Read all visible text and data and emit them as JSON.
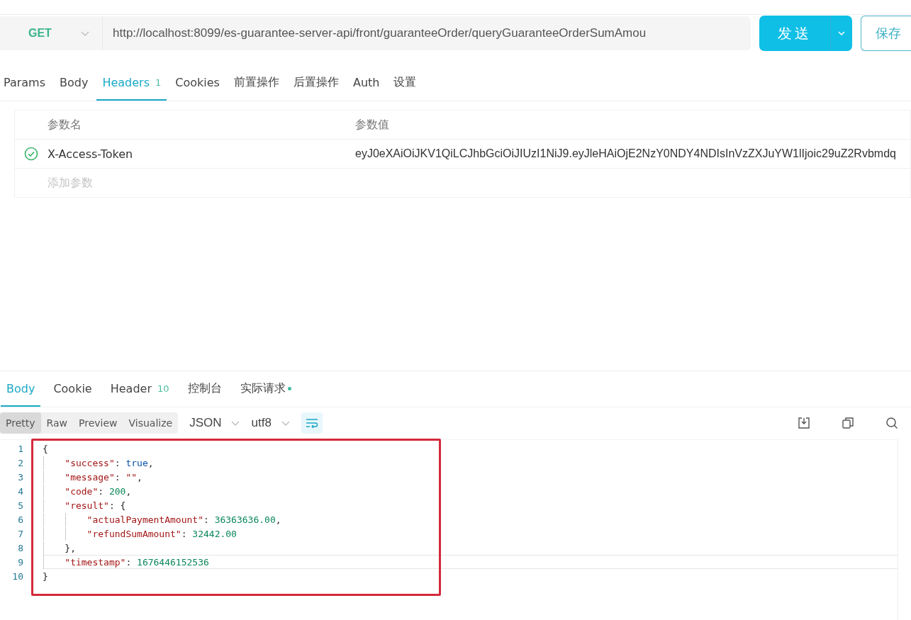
{
  "request": {
    "method": "GET",
    "url": "http://localhost:8099/es-guarantee-server-api/front/guaranteeOrder/queryGuaranteeOrderSumAmou",
    "send_label": "发送",
    "save_label": "保存"
  },
  "request_tabs": [
    {
      "label": "Params",
      "selected": false
    },
    {
      "label": "Body",
      "selected": false
    },
    {
      "label": "Headers",
      "count": "1",
      "selected": true
    },
    {
      "label": "Cookies",
      "selected": false
    },
    {
      "label": "前置操作",
      "selected": false
    },
    {
      "label": "后置操作",
      "selected": false
    },
    {
      "label": "Auth",
      "selected": false
    },
    {
      "label": "设置",
      "selected": false
    }
  ],
  "headers_table": {
    "columns": [
      "参数名",
      "参数值"
    ],
    "rows": [
      {
        "enabled": true,
        "name": "X-Access-Token",
        "value": "eyJ0eXAiOiJKV1QiLCJhbGciOiJIUzI1NiJ9.eyJleHAiOjE2NzY0NDY4NDIsInVzZXJuYW1lIjoic29uZ2Rvbmdq"
      }
    ],
    "add_placeholder": "添加参数"
  },
  "response_tabs": [
    {
      "label": "Body",
      "selected": true
    },
    {
      "label": "Cookie",
      "selected": false
    },
    {
      "label": "Header",
      "count": "10",
      "selected": false
    },
    {
      "label": "控制台",
      "selected": false
    },
    {
      "label": "实际请求",
      "dot": true,
      "selected": false
    }
  ],
  "view_modes": [
    {
      "label": "Pretty",
      "selected": true
    },
    {
      "label": "Raw",
      "selected": false
    },
    {
      "label": "Preview",
      "selected": false
    },
    {
      "label": "Visualize",
      "selected": false
    }
  ],
  "format": "JSON",
  "encoding": "utf8",
  "wrap_on": true,
  "code_lines": [
    {
      "number": "1",
      "current": false,
      "tokens": [
        {
          "kind": "punct",
          "text": "{"
        }
      ]
    },
    {
      "number": "2",
      "current": false,
      "tokens": [
        {
          "kind": "key",
          "text": "    \"success\""
        },
        {
          "kind": "punct",
          "text": ": "
        },
        {
          "kind": "bool",
          "text": "true"
        },
        {
          "kind": "punct",
          "text": ","
        }
      ]
    },
    {
      "number": "3",
      "current": false,
      "tokens": [
        {
          "kind": "key",
          "text": "    \"message\""
        },
        {
          "kind": "punct",
          "text": ": "
        },
        {
          "kind": "string",
          "text": "\"\""
        },
        {
          "kind": "punct",
          "text": ","
        }
      ]
    },
    {
      "number": "4",
      "current": false,
      "tokens": [
        {
          "kind": "key",
          "text": "    \"code\""
        },
        {
          "kind": "punct",
          "text": ": "
        },
        {
          "kind": "number",
          "text": "200"
        },
        {
          "kind": "punct",
          "text": ","
        }
      ]
    },
    {
      "number": "5",
      "current": false,
      "tokens": [
        {
          "kind": "key",
          "text": "    \"result\""
        },
        {
          "kind": "punct",
          "text": ": {"
        }
      ]
    },
    {
      "number": "6",
      "current": false,
      "tokens": [
        {
          "kind": "key",
          "text": "        \"actualPaymentAmount\""
        },
        {
          "kind": "punct",
          "text": ": "
        },
        {
          "kind": "number",
          "text": "36363636.00"
        },
        {
          "kind": "punct",
          "text": ","
        }
      ]
    },
    {
      "number": "7",
      "current": false,
      "tokens": [
        {
          "kind": "key",
          "text": "        \"refundSumAmount\""
        },
        {
          "kind": "punct",
          "text": ": "
        },
        {
          "kind": "number",
          "text": "32442.00"
        }
      ]
    },
    {
      "number": "8",
      "current": false,
      "tokens": [
        {
          "kind": "punct",
          "text": "    },"
        }
      ]
    },
    {
      "number": "9",
      "current": true,
      "tokens": [
        {
          "kind": "key",
          "text": "    \"timestamp\""
        },
        {
          "kind": "punct",
          "text": ": "
        },
        {
          "kind": "number",
          "text": "1676446152536"
        }
      ]
    },
    {
      "number": "10",
      "current": false,
      "tokens": [
        {
          "kind": "punct",
          "text": "}"
        }
      ]
    }
  ]
}
